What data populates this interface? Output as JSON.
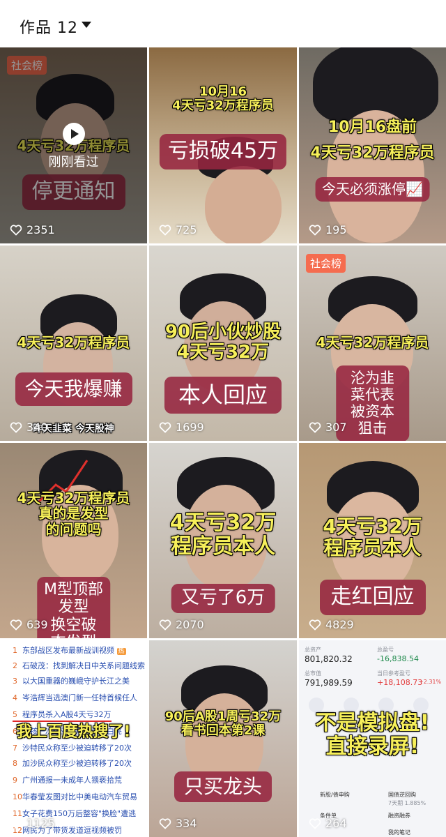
{
  "header": {
    "title": "作品 12"
  },
  "tiles": [
    {
      "badge": "社会榜",
      "caption_top": "4天亏32万程序员",
      "caption_box": "停更通知",
      "overlay": "刚刚看过",
      "likes": "2351"
    },
    {
      "caption_top": "10月16\n4天亏32万程序员",
      "caption_box": "亏损破45万",
      "likes": "725"
    },
    {
      "caption_top": "10月16盘前\n4天亏32万程序员",
      "caption_box": "今天必须涨停📈",
      "likes": "195"
    },
    {
      "caption_top": "4天亏32万程序员",
      "caption_box": "今天我爆赚",
      "caption_bottom": "昨天韭菜 今天股神",
      "likes": "340"
    },
    {
      "caption_top": "90后小伙炒股\n4天亏32万",
      "caption_box": "本人回应",
      "likes": "1699"
    },
    {
      "badge": "社会榜",
      "caption_top": "4天亏32万程序员",
      "caption_box": "沦为韭菜代表\n被资本狙击",
      "likes": "307"
    },
    {
      "caption_top": "4天亏32万程序员\n真的是发型\n的问题吗",
      "caption_box": "M型顶部发型\n换空破态发型",
      "likes": "639"
    },
    {
      "caption_top": "4天亏32万\n程序员本人",
      "caption_box": "又亏了6万",
      "likes": "2070"
    },
    {
      "caption_top": "4天亏32万\n程序员本人",
      "caption_box": "走红回应",
      "likes": "4829"
    },
    {
      "news": [
        {
          "n": "1",
          "t": "东部战区发布最新战训视频"
        },
        {
          "n": "2",
          "t": "石破茂：找到解决日中关系问题线索"
        },
        {
          "n": "3",
          "t": "以大国重器的巍峨守护长江之美"
        },
        {
          "n": "4",
          "t": "岑浩辉当选澳门新一任特首候任人"
        },
        {
          "n": "5",
          "t": "程序员杀入A股4天亏32万"
        },
        {
          "n": "6",
          "t": "男孩一次迪亚哈前碰瓷的白亮"
        },
        {
          "n": "7",
          "t": "沙特民众称至少被迫转移了20次"
        },
        {
          "n": "8",
          "t": "加沙民众称至少被迫转移了20次"
        },
        {
          "n": "9",
          "t": "广州通报一未成年人猥亵拾荒"
        },
        {
          "n": "10",
          "t": "华春莹发图对比中美电动汽车贸易"
        },
        {
          "n": "11",
          "t": "女子花费150万后整容\"换脸\"遭逃"
        },
        {
          "n": "12",
          "t": "网民为了带货发道逗视频被罚"
        }
      ],
      "caption_top": "我上百度热搜了!",
      "hot_tag": "热",
      "likes": "1125"
    },
    {
      "caption_top": "90后A股1周亏32万\n看书回本第2课",
      "caption_box": "只买龙头",
      "likes": "334"
    },
    {
      "finance": {
        "total_label": "总资产",
        "total": "801,820.32",
        "pnl_label": "总盈亏",
        "pnl": "-16,838.54",
        "market_label": "总市值",
        "market": "791,989.59",
        "today_label": "当日参考盈亏",
        "today": "+18,108.73",
        "today_pct": "+2.31%",
        "items": [
          "新股/债申购",
          "国债逆回购",
          "条件单",
          "融资融券",
          "我的笔记"
        ],
        "hint": "7天期 1.885%"
      },
      "caption_top": "不是模拟盘!\n直接录屏!",
      "likes": "264"
    }
  ],
  "colors": {
    "accent_box": "#962640",
    "caption_yellow": "#f6ef5a",
    "badge": "#f56c4f"
  }
}
